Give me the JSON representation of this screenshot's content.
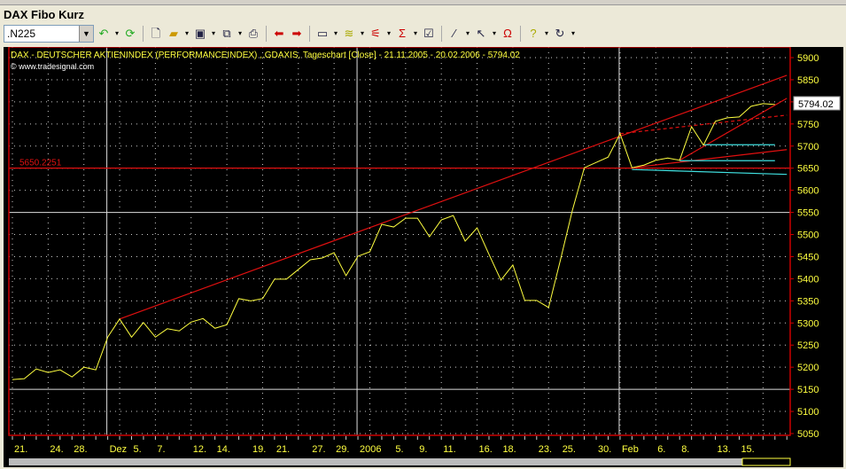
{
  "window": {
    "title": "DAX Fibo Kurz"
  },
  "toolbar": {
    "symbol_value": ".N225",
    "buttons": [
      "refresh-icon",
      "update-icon",
      "new-icon",
      "open-icon",
      "save-icon",
      "copy-icon",
      "print-icon",
      "chart-back-icon",
      "chart-forward-icon",
      "window-icon",
      "indicator-icon",
      "strategy-icon",
      "formula-icon",
      "properties-icon",
      "draw-line-icon",
      "pointer-icon",
      "magnet-icon",
      "help-icon",
      "undo-icon"
    ]
  },
  "colors": {
    "background": "#000000",
    "price": "#ffff40",
    "trend": "#e01010",
    "fibo": "#40e0e0",
    "frame": "#cc0000",
    "axis_text": "#ffff40"
  },
  "chart_data": {
    "type": "line",
    "header": "DAX - DEUTSCHER AKTIENINDEX (PERFORMANCEINDEX) ,.GDAXIS, Tageschart [Close] - 21.11.2005 - 20.02.2006 - 5794.02",
    "copyright": "© www.tradesignal.com",
    "ylim": [
      5050,
      5900
    ],
    "yticks": [
      5900,
      5850,
      5800,
      5750,
      5700,
      5650,
      5600,
      5550,
      5500,
      5450,
      5400,
      5350,
      5300,
      5250,
      5200,
      5150,
      5100,
      5050
    ],
    "xlabels": [
      {
        "label": "21.",
        "i": 0
      },
      {
        "label": "24.",
        "i": 3
      },
      {
        "label": "28.",
        "i": 5
      },
      {
        "label": "Dez",
        "i": 8
      },
      {
        "label": "5.",
        "i": 10
      },
      {
        "label": "7.",
        "i": 12
      },
      {
        "label": "12.",
        "i": 15
      },
      {
        "label": "14.",
        "i": 17
      },
      {
        "label": "19.",
        "i": 20
      },
      {
        "label": "21.",
        "i": 22
      },
      {
        "label": "27.",
        "i": 25
      },
      {
        "label": "29.",
        "i": 27
      },
      {
        "label": "2006",
        "i": 29
      },
      {
        "label": "5.",
        "i": 32
      },
      {
        "label": "9.",
        "i": 34
      },
      {
        "label": "11.",
        "i": 36
      },
      {
        "label": "16.",
        "i": 39
      },
      {
        "label": "18.",
        "i": 41
      },
      {
        "label": "23.",
        "i": 44
      },
      {
        "label": "25.",
        "i": 46
      },
      {
        "label": "30.",
        "i": 49
      },
      {
        "label": "Feb",
        "i": 51
      },
      {
        "label": "6.",
        "i": 54
      },
      {
        "label": "8.",
        "i": 56
      },
      {
        "label": "13.",
        "i": 59
      },
      {
        "label": "15.",
        "i": 61
      }
    ],
    "close": [
      5172,
      5174,
      5196,
      5188,
      5194,
      5178,
      5200,
      5194,
      5268,
      5309,
      5268,
      5301,
      5268,
      5287,
      5282,
      5302,
      5310,
      5288,
      5296,
      5355,
      5350,
      5355,
      5399,
      5399,
      5421,
      5443,
      5447,
      5459,
      5407,
      5451,
      5461,
      5523,
      5517,
      5537,
      5537,
      5495,
      5533,
      5543,
      5485,
      5515,
      5455,
      5397,
      5431,
      5351,
      5351,
      5335,
      5443,
      5555,
      5651,
      5663,
      5675,
      5728,
      5651,
      5657,
      5668,
      5673,
      5668,
      5744,
      5702,
      5756,
      5764,
      5766,
      5790,
      5796,
      5794.02
    ],
    "last_value": "5794.02",
    "hline": {
      "label": "5650.2251",
      "value": 5650.2251
    },
    "trendlines": [
      {
        "kind": "solid",
        "color": "#e01010",
        "from": [
          9,
          5309
        ],
        "to": [
          65,
          5860
        ]
      },
      {
        "kind": "dashed",
        "color": "#e01010",
        "from": [
          51,
          5728
        ],
        "to": [
          65,
          5770
        ]
      },
      {
        "kind": "solid",
        "color": "#e01010",
        "from": [
          52,
          5651
        ],
        "to": [
          65,
          5692
        ]
      },
      {
        "kind": "solid",
        "color": "#e01010",
        "from": [
          56,
          5668
        ],
        "to": [
          65,
          5808
        ]
      },
      {
        "kind": "solid",
        "color": "#40e0e0",
        "from": [
          52,
          5647
        ],
        "to": [
          65,
          5636
        ]
      },
      {
        "kind": "solid",
        "color": "#40e0e0",
        "from": [
          56,
          5667
        ],
        "to": [
          64,
          5667
        ]
      },
      {
        "kind": "solid",
        "color": "#40e0e0",
        "from": [
          58,
          5703
        ],
        "to": [
          64,
          5703
        ]
      }
    ]
  }
}
